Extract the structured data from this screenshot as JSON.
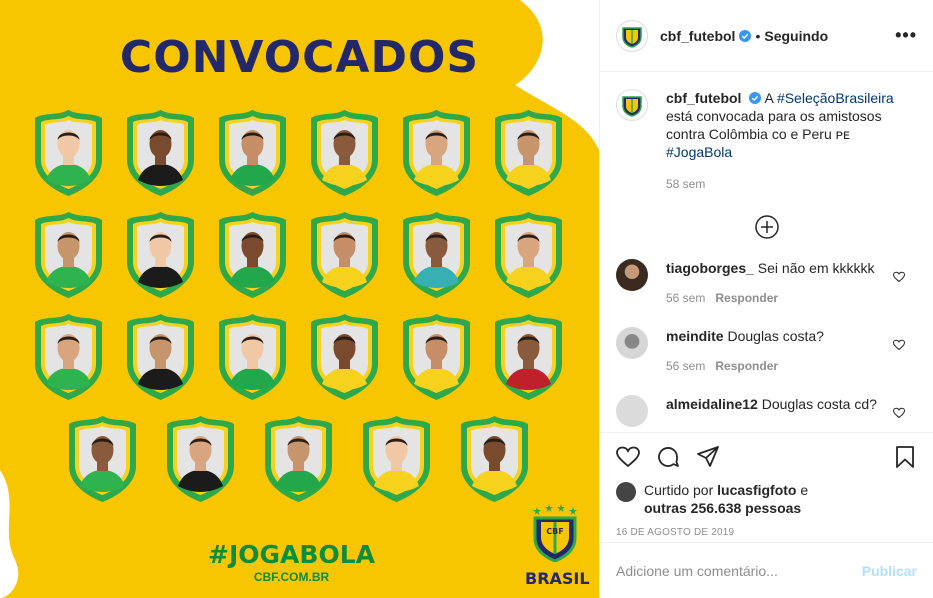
{
  "image": {
    "headline": "CONVOCADOS",
    "hashtag": "#JOGABOLA",
    "site": "CBF.COM.BR",
    "crest_word": "BRASIL",
    "crest_letters": "CBF",
    "colors": {
      "background": "#F7C600",
      "navy": "#23286B",
      "green": "#0E8C3A",
      "badge_green": "#2DA84A"
    },
    "player_rows": [
      6,
      6,
      6,
      5
    ]
  },
  "header": {
    "username": "cbf_futebol",
    "separator": "•",
    "follow_label": "Seguindo",
    "more_icon": "more-horizontal-icon"
  },
  "caption": {
    "username": "cbf_futebol",
    "text_before": "A",
    "hashtag1": "#SeleçãoBrasileira",
    "text_middle": "está convocada para os amistosos contra Colômbia co e Peru",
    "flag_text": "ᴘᴇ",
    "hashtag2": "#JogaBola",
    "time": "58 sem"
  },
  "load_more_icon": "plus-circle-icon",
  "comments": [
    {
      "username": "tiagoborges_",
      "text": "Sei não em kkkkkk",
      "time": "56 sem",
      "reply": "Responder"
    },
    {
      "username": "meindite",
      "text": "Douglas costa?",
      "time": "56 sem",
      "reply": "Responder"
    },
    {
      "username": "almeidaline12",
      "text": "Douglas costa cd?",
      "time": "",
      "reply": ""
    }
  ],
  "actions": {
    "icons": [
      "heart-icon",
      "comment-icon",
      "share-icon",
      "bookmark-icon"
    ],
    "liked_by_prefix": "Curtido por",
    "liked_by_user": "lucasfigfoto",
    "liked_by_and": "e",
    "others": "outras 256.638 pessoas",
    "date": "16 DE AGOSTO DE 2019"
  },
  "add_comment": {
    "placeholder": "Adicione um comentário...",
    "post_label": "Publicar"
  }
}
